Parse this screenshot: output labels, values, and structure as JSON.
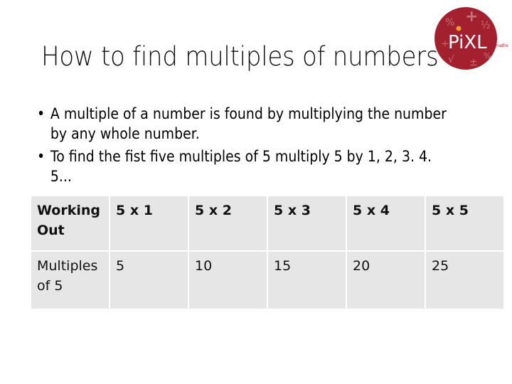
{
  "slide": {
    "title": "How to find multiples of numbers",
    "logo": {
      "name": "PiXL maths",
      "brand_text": "PiXL",
      "sub_text": "maths",
      "circle_color": "#a3212e",
      "dot_color": "#f29a2e"
    },
    "bullets": [
      {
        "text": "A multiple of a number is found by multiplying the number by any whole number."
      },
      {
        "text": "To find the fist five multiples of 5 multiply 5 by 1, 2, 3. 4. 5..."
      }
    ],
    "bullet_glyph": "•",
    "table": {
      "rows": [
        {
          "cells": [
            "Working Out",
            "5 x 1",
            "5 x 2",
            "5 x 3",
            "5 x 4",
            "5 x 5"
          ]
        },
        {
          "cells": [
            "Multiples of 5",
            "5",
            "10",
            "15",
            "20",
            "25"
          ]
        }
      ]
    }
  }
}
